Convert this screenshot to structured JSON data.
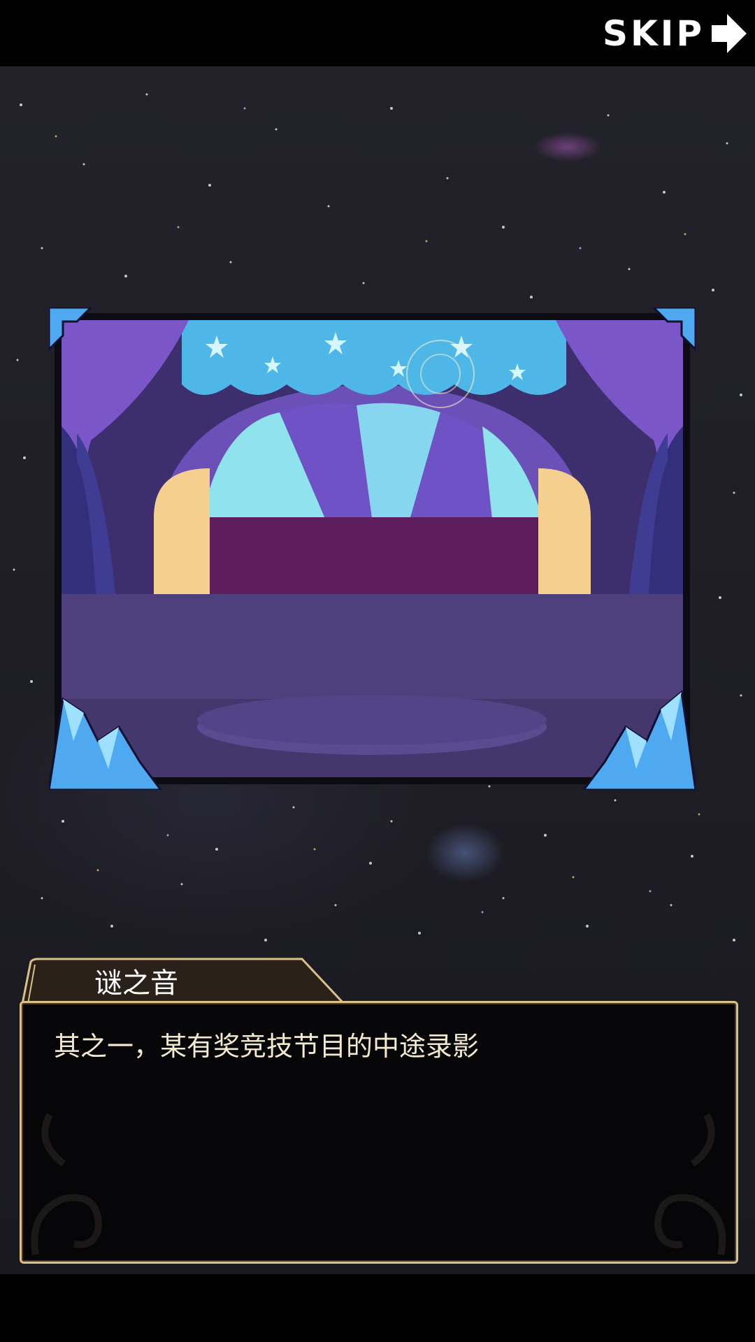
{
  "top_bar": {
    "skip_label": "SKIP"
  },
  "dialog": {
    "speaker": "谜之音",
    "text": "其之一，某有奖竞技节目的中途录影"
  },
  "colors": {
    "frame_gold": "#d8c08a",
    "curtain_purple": "#5a3ea0",
    "dome_cyan": "#7fe0f0",
    "crystal_blue": "#4fa9f0"
  },
  "icons": [
    "arrow-right-icon",
    "crystal-icon"
  ]
}
